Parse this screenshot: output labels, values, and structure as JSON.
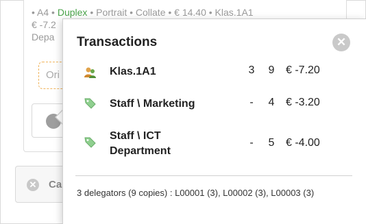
{
  "background": {
    "meta_a4": "• A4 •",
    "meta_duplex": "Duplex",
    "meta_rest": "• Portrait • Collate • € 14.40 • Klas.1A1",
    "meta_line2": "€ -7.2",
    "meta_line3": "Depa",
    "original_label": "Ori",
    "cancel_label": "Ca"
  },
  "popover": {
    "title": "Transactions",
    "close_icon": "close-circle-icon",
    "rows": [
      {
        "icon": "users-icon",
        "name": "Klas.1A1",
        "n1": "3",
        "n2": "9",
        "amount": "€ -7.20"
      },
      {
        "icon": "tag-icon",
        "name": "Staff \\ Marketing",
        "n1": "-",
        "n2": "4",
        "amount": "€ -3.20"
      },
      {
        "icon": "tag-icon",
        "name": "Staff \\ ICT Department",
        "n1": "-",
        "n2": "5",
        "amount": "€ -4.00"
      }
    ],
    "footer": "3 delegators (9 copies) : L00001 (3), L00002 (3), L00003 (3)"
  },
  "colors": {
    "green": "#4aa34a",
    "tag": "#7cc47c",
    "close": "#c9c9c9"
  }
}
